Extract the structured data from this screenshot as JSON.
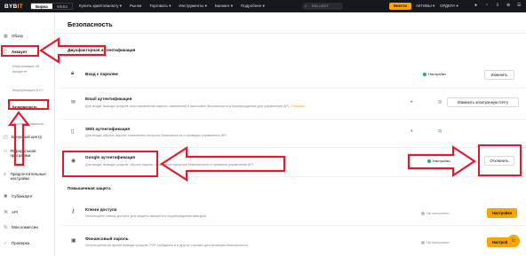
{
  "topbar": {
    "logo_main": "BYB",
    "logo_accent": "IT",
    "toggle": [
      "Биржа",
      "WEB3"
    ],
    "nav": [
      "Купить криптовалюту ▾",
      "Рынки",
      "Торговать ▾",
      "Инструменты ▾",
      "Банкинг ▾",
      "Подробнее ▾"
    ],
    "search_placeholder": "BNLUSDT",
    "deposit_label": "Внести",
    "assets_label": "АКТИВЫ ▾",
    "orders_label": "ОРДЕРА ▾"
  },
  "sidebar": {
    "overview": "Обзор",
    "account": "Аккаунт",
    "account_info": "Информация об аккаунте",
    "kyc": "Верификация KYC",
    "security": "Безопасность",
    "ellipsis": "Экспортированная...",
    "bonus": "Бонусный центр",
    "referral": "Реферальная программа",
    "prefs": "Предпочтительные настройки",
    "subaccount": "Субаккаунт",
    "api": "API",
    "fees": "Мои комиссии",
    "verify": "Проверка"
  },
  "main": {
    "title": "Безопасность",
    "section_2fa": "Двухфакторная аутентификация",
    "section_extra": "Повышенная защита",
    "rows": [
      {
        "title": "Вход с паролем",
        "desc": "",
        "warn": "",
        "status": "Настройки",
        "button": "Изменить"
      },
      {
        "title": "Email аутентификация",
        "desc": "Для входа, вывода средств, восстановления пароля, изменений в настройке безопасности и подтверждения для управления API.",
        "warn": "Отвязать",
        "status": "",
        "button": "Изменить электронную почту"
      },
      {
        "title": "SMS аутентификация",
        "desc": "Для входа, сброса пароля, изменения настроек безопасности и проверки управления API.",
        "warn": "",
        "status": "",
        "button": ""
      },
      {
        "title": "Google аутентификация",
        "desc": "Для входа, вывода средств, сброса пароля, изменения настроек безопасности и проверки управления API.",
        "warn": "",
        "status": "Настройки",
        "button": "Отключить"
      },
      {
        "title": "Ключи доступа",
        "desc": "Используйте ключи доступа для защиты аккаунта и подтверждения выводов.",
        "warn": "",
        "status": "Не настроено",
        "button": "Настройки"
      },
      {
        "title": "Финансовый пароль",
        "desc": "Используется во время вывода средств, P2P-трейдинга и в других случаях для проверки безопасности.",
        "warn": "",
        "status": "Не настроено",
        "button": "Настройки"
      }
    ]
  },
  "colors": {
    "accent": "#f7a600",
    "annotation": "#e8182c",
    "ok": "#20b26c"
  }
}
